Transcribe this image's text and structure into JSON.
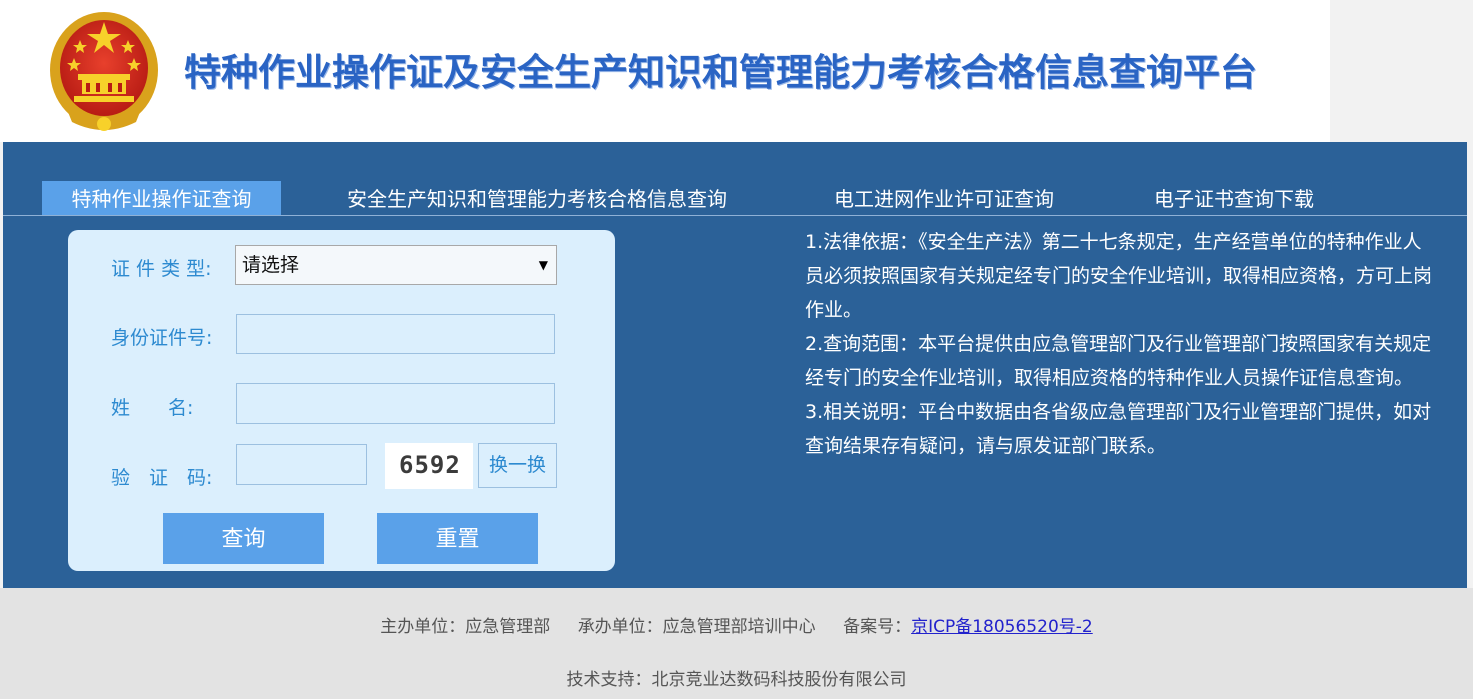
{
  "header": {
    "title": "特种作业操作证及安全生产知识和管理能力考核合格信息查询平台"
  },
  "tabs": [
    {
      "label": "特种作业操作证查询",
      "active": true
    },
    {
      "label": "安全生产知识和管理能力考核合格信息查询",
      "active": false
    },
    {
      "label": "电工进网作业许可证查询",
      "active": false
    },
    {
      "label": "电子证书查询下载",
      "active": false
    }
  ],
  "form": {
    "cert_type_label": "证 件 类 型:",
    "cert_type_value": "请选择",
    "id_label": "身份证件号:",
    "id_value": "",
    "name_label": "姓　　名:",
    "name_value": "",
    "captcha_label": "验　证　码:",
    "captcha_value": "",
    "captcha_text": "6592",
    "refresh_label": "换一换",
    "query_label": "查询",
    "reset_label": "重置"
  },
  "notes": [
    "1.法律依据：《安全生产法》第二十七条规定，生产经营单位的特种作业人员必须按照国家有关规定经专门的安全作业培训，取得相应资格，方可上岗作业。",
    "2.查询范围：本平台提供由应急管理部门及行业管理部门按照国家有关规定经专门的安全作业培训，取得相应资格的特种作业人员操作证信息查询。",
    "3.相关说明：平台中数据由各省级应急管理部门及行业管理部门提供，如对查询结果存有疑问，请与原发证部门联系。"
  ],
  "footer": {
    "host": "主办单位：应急管理部",
    "organizer": "承办单位：应急管理部培训中心",
    "record_label": "备案号：",
    "icp": "京ICP备18056520号-2",
    "support": "技术支持：北京竞业达数码科技股份有限公司"
  },
  "colors": {
    "main_bg": "#2b6198",
    "active_tab": "#5aa1e9",
    "form_bg": "#dbeffd",
    "label_text": "#2d8ad0",
    "title_text": "#2a64c4"
  }
}
